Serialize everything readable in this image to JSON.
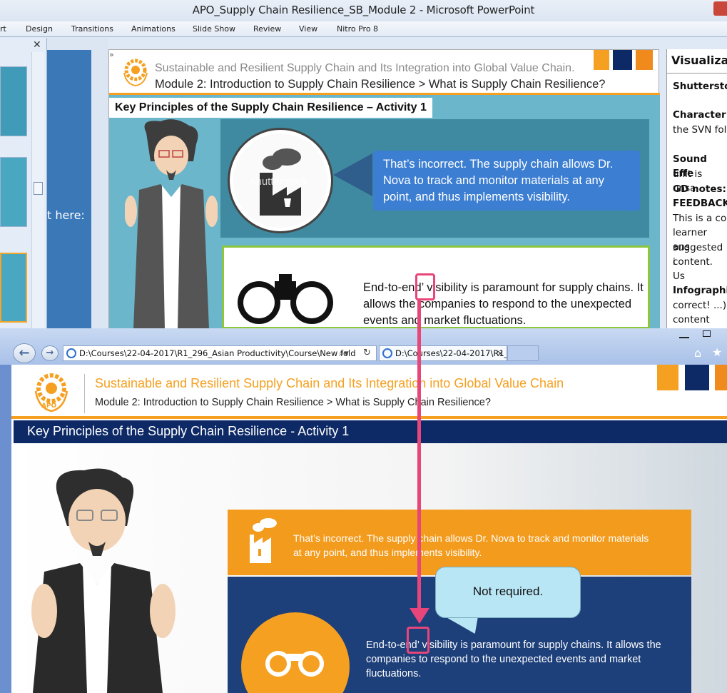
{
  "ppt": {
    "title": "APO_Supply Chain Resilience_SB_Module 2  -  Microsoft PowerPoint",
    "ribbon_tabs": [
      "rt",
      "Design",
      "Transitions",
      "Animations",
      "Slide Show",
      "Review",
      "View",
      "Nitro Pro 8"
    ],
    "notes_text": "t here:",
    "slide": {
      "header_line1": "Sustainable and Resilient Supply Chain and Its Integration into Global Value Chain.",
      "header_line2": "Module 2: Introduction to Supply Chain Resilience > What is Supply Chain Resilience?",
      "title": "Key Principles of the Supply Chain Resilience – Activity 1",
      "feedback": "That’s incorrect. The supply chain allows Dr. Nova to track and monitor materials at any point, and thus implements visibility.",
      "watermark": "shutterstock",
      "body": "End-to-end’ visibility is paramount for supply chains. It allows the companies to respond to the unexpected events and market fluctuations."
    },
    "right_notes": [
      {
        "text": "Visualizat",
        "bold": true
      },
      {
        "text": "Shutterstoc",
        "bold": true
      },
      {
        "text": "",
        "bold": false
      },
      {
        "text": "Character:",
        "bold": true
      },
      {
        "text": "the SVN fol",
        "bold": false
      },
      {
        "text": "",
        "bold": false
      },
      {
        "text": "Sound Effe",
        "bold": true
      },
      {
        "text": "unit is unsa",
        "bold": false
      },
      {
        "text": "GD notes:",
        "bold": true
      },
      {
        "text": "FEEDBACK",
        "bold": true
      },
      {
        "text": "This is a co",
        "bold": false
      },
      {
        "text": "learner ans",
        "bold": false
      },
      {
        "text": "suggested i",
        "bold": false
      },
      {
        "text": "content. Us",
        "bold": false
      },
      {
        "text": "",
        "bold": false
      },
      {
        "text": "Infographic",
        "bold": true
      },
      {
        "text": "correct! ...)",
        "bold": false
      },
      {
        "text": "content",
        "bold": false
      }
    ]
  },
  "ie": {
    "address": "D:\\Courses\\22-04-2017\\R1_296_Asian Productivity\\Course\\New fold",
    "tab_label": "D:\\Courses\\22-04-2017\\R1_...",
    "page": {
      "header_line1": "Sustainable and Resilient Supply Chain and Its Integration into Global Value Chain",
      "header_line2": "Module 2: Introduction to Supply Chain Resilience > What is Supply Chain Resilience?",
      "logo_text": "APO",
      "title": "Key Principles of the Supply Chain Resilience - Activity 1",
      "feedback": "That’s incorrect. The supply chain allows Dr. Nova to track and monitor materials at any point, and thus implements visibility.",
      "body": "End-to-end’ visibility is paramount for supply chains. It allows the companies to respond to the unexpected events and market fluctuations."
    }
  },
  "annotation": {
    "callout_text": "Not required."
  },
  "colors": {
    "orange": "#f5a020",
    "navy": "#0e2a66",
    "teal": "#5aa9bf",
    "pink": "#e8457a"
  }
}
